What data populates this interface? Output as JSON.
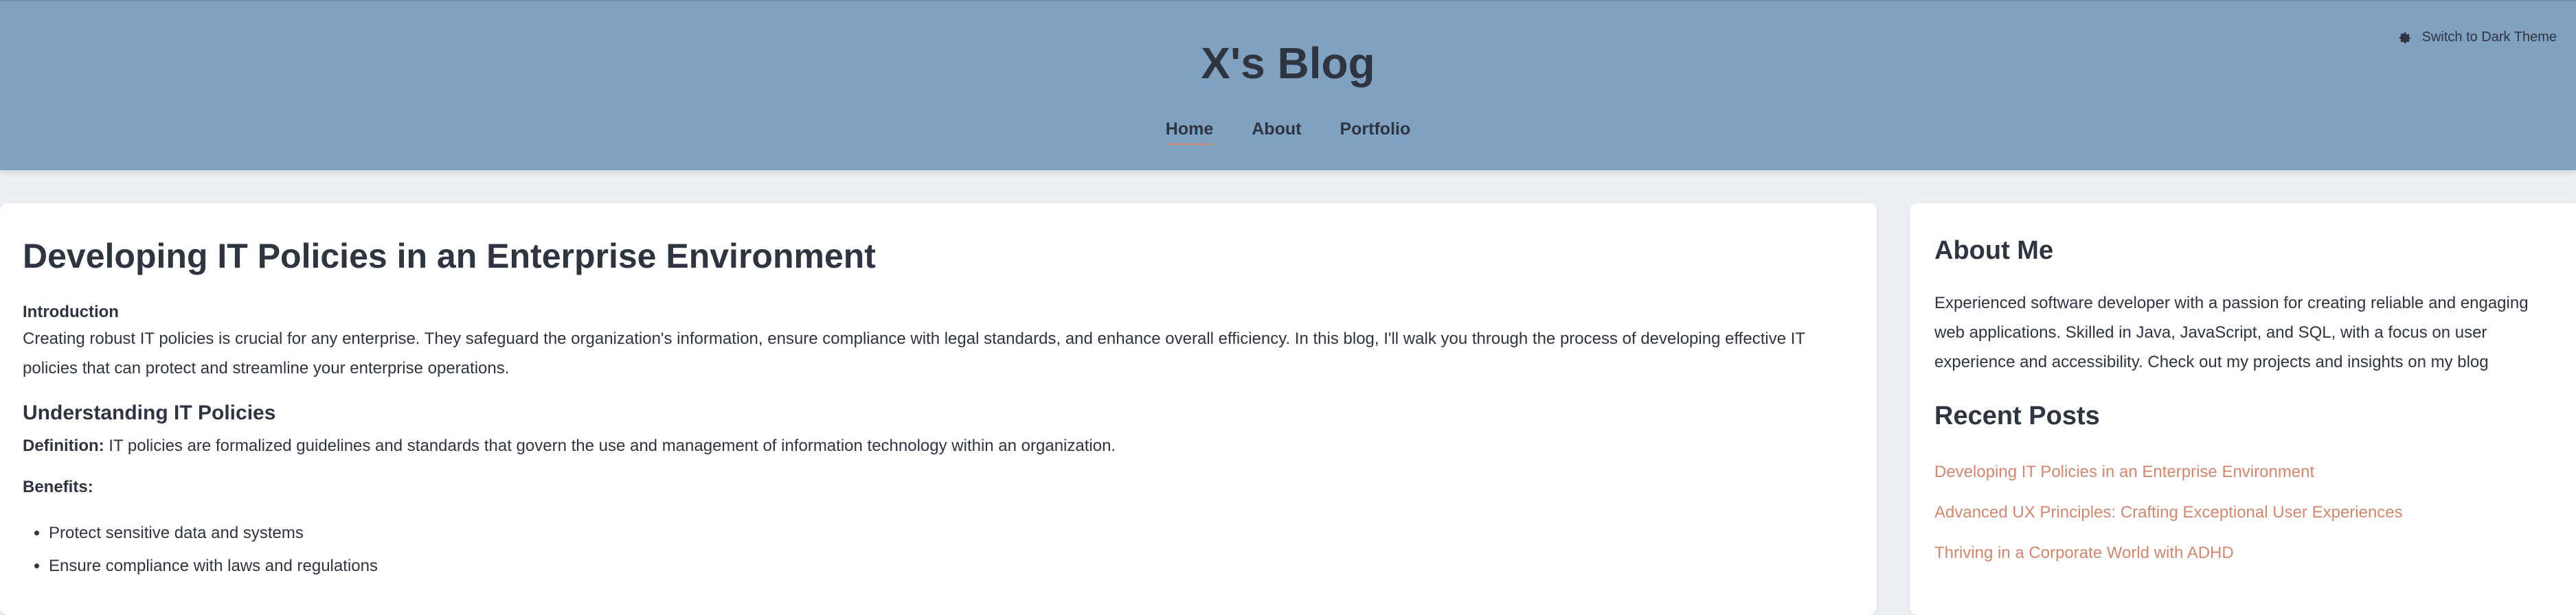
{
  "header": {
    "title": "X's Blog",
    "theme_toggle_label": "Switch to Dark Theme",
    "nav": [
      {
        "label": "Home",
        "active": true
      },
      {
        "label": "About",
        "active": false
      },
      {
        "label": "Portfolio",
        "active": false
      }
    ]
  },
  "article": {
    "title": "Developing IT Policies in an Enterprise Environment",
    "intro_label": "Introduction",
    "intro_text": "Creating robust IT policies is crucial for any enterprise. They safeguard the organization's information, ensure compliance with legal standards, and enhance overall efficiency. In this blog, I'll walk you through the process of developing effective IT policies that can protect and streamline your enterprise operations.",
    "section_heading": "Understanding IT Policies",
    "definition_label": "Definition:",
    "definition_text": " IT policies are formalized guidelines and standards that govern the use and management of information technology within an organization.",
    "benefits_label": "Benefits:",
    "benefits": [
      "Protect sensitive data and systems",
      "Ensure compliance with laws and regulations"
    ]
  },
  "sidebar": {
    "about_heading": "About Me",
    "about_text": "Experienced software developer with a passion for creating reliable and engaging web applications. Skilled in Java, JavaScript, and SQL, with a focus on user experience and accessibility. Check out my projects and insights on my blog",
    "recent_heading": "Recent Posts",
    "recent_posts": [
      "Developing IT Policies in an Enterprise Environment",
      "Advanced UX Principles: Crafting Exceptional User Experiences",
      "Thriving in a Corporate World with ADHD"
    ]
  },
  "colors": {
    "header_bg": "#81a1c1",
    "page_bg": "#eceff4",
    "text": "#2e3440",
    "accent": "#d08770"
  },
  "icons": {
    "theme_toggle": "gear-icon"
  }
}
